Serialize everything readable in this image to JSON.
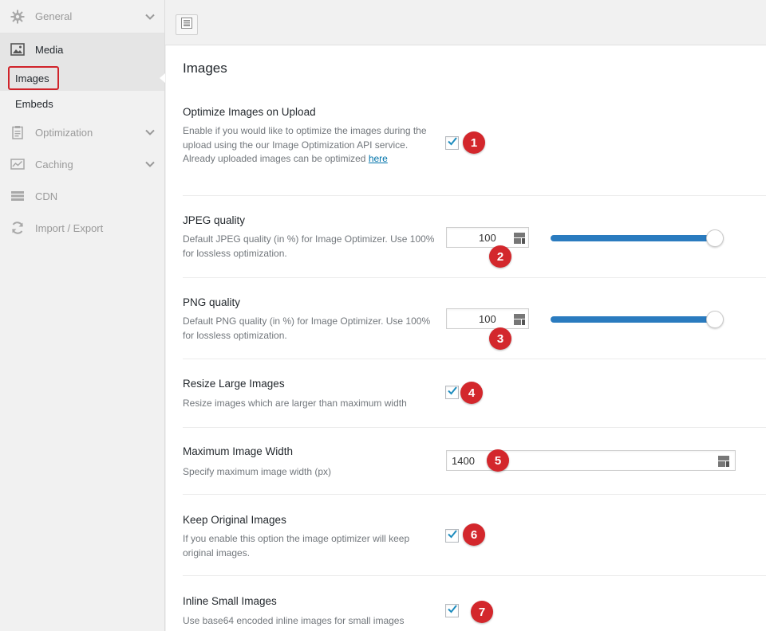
{
  "sidebar": {
    "general": "General",
    "media": "Media",
    "images": "Images",
    "embeds": "Embeds",
    "optimization": "Optimization",
    "caching": "Caching",
    "cdn": "CDN",
    "import_export": "Import / Export"
  },
  "section": {
    "title": "Images"
  },
  "settings": {
    "optimize": {
      "title": "Optimize Images on Upload",
      "desc_before_link": "Enable if you would like to optimize the images during the upload using the our Image Optimization API service. Already uploaded images can be optimized ",
      "link": "here",
      "checked": true,
      "badge": "1"
    },
    "jpeg": {
      "title": "JPEG quality",
      "desc": "Default JPEG quality (in %) for Image Optimizer. Use 100% for lossless optimization.",
      "value": "100",
      "slider_level": 100,
      "badge": "2"
    },
    "png": {
      "title": "PNG quality",
      "desc": "Default PNG quality (in %) for Image Optimizer. Use 100% for lossless optimization.",
      "value": "100",
      "slider_level": 100,
      "badge": "3"
    },
    "resize": {
      "title": "Resize Large Images",
      "desc": "Resize images which are larger than maximum width",
      "checked": true,
      "badge": "4"
    },
    "max_width": {
      "title": "Maximum Image Width",
      "desc": "Specify maximum image width (px)",
      "value": "1400",
      "badge": "5"
    },
    "keep_original": {
      "title": "Keep Original Images",
      "desc": "If you enable this option the image optimizer will keep original images.",
      "checked": true,
      "badge": "6"
    },
    "inline_small": {
      "title": "Inline Small Images",
      "desc": "Use base64 encoded inline images for small images",
      "checked": true,
      "badge": "7"
    }
  },
  "colors": {
    "accent": "#2a7bbf",
    "badge": "#d3272c",
    "highlight_border": "#d0232a",
    "link": "#0073aa"
  }
}
